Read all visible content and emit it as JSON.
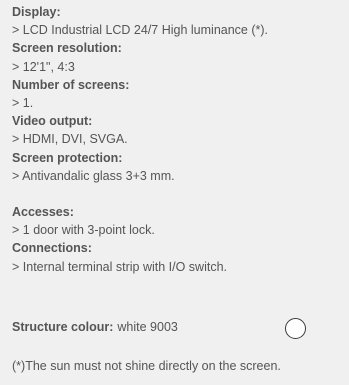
{
  "specs": {
    "display_label": "Display:",
    "display_value": "> LCD Industrial LCD 24/7 High luminance (*).",
    "resolution_label": "Screen resolution:",
    "resolution_value": "> 12'1\", 4:3",
    "screens_label": "Number of screens:",
    "screens_value": "> 1.",
    "video_label": "Video output:",
    "video_value": "> HDMI, DVI, SVGA.",
    "protection_label": "Screen protection:",
    "protection_value": "> Antivandalic glass 3+3 mm.",
    "accesses_label": "Accesses:",
    "accesses_value": "> 1 door with 3-point lock.",
    "connections_label": "Connections:",
    "connections_value": "> Internal terminal strip with I/O switch."
  },
  "structure": {
    "label": "Structure colour:",
    "value": "white 9003",
    "swatch_color": "#ffffff"
  },
  "footnote": "(*)The sun must not shine directly on the screen."
}
